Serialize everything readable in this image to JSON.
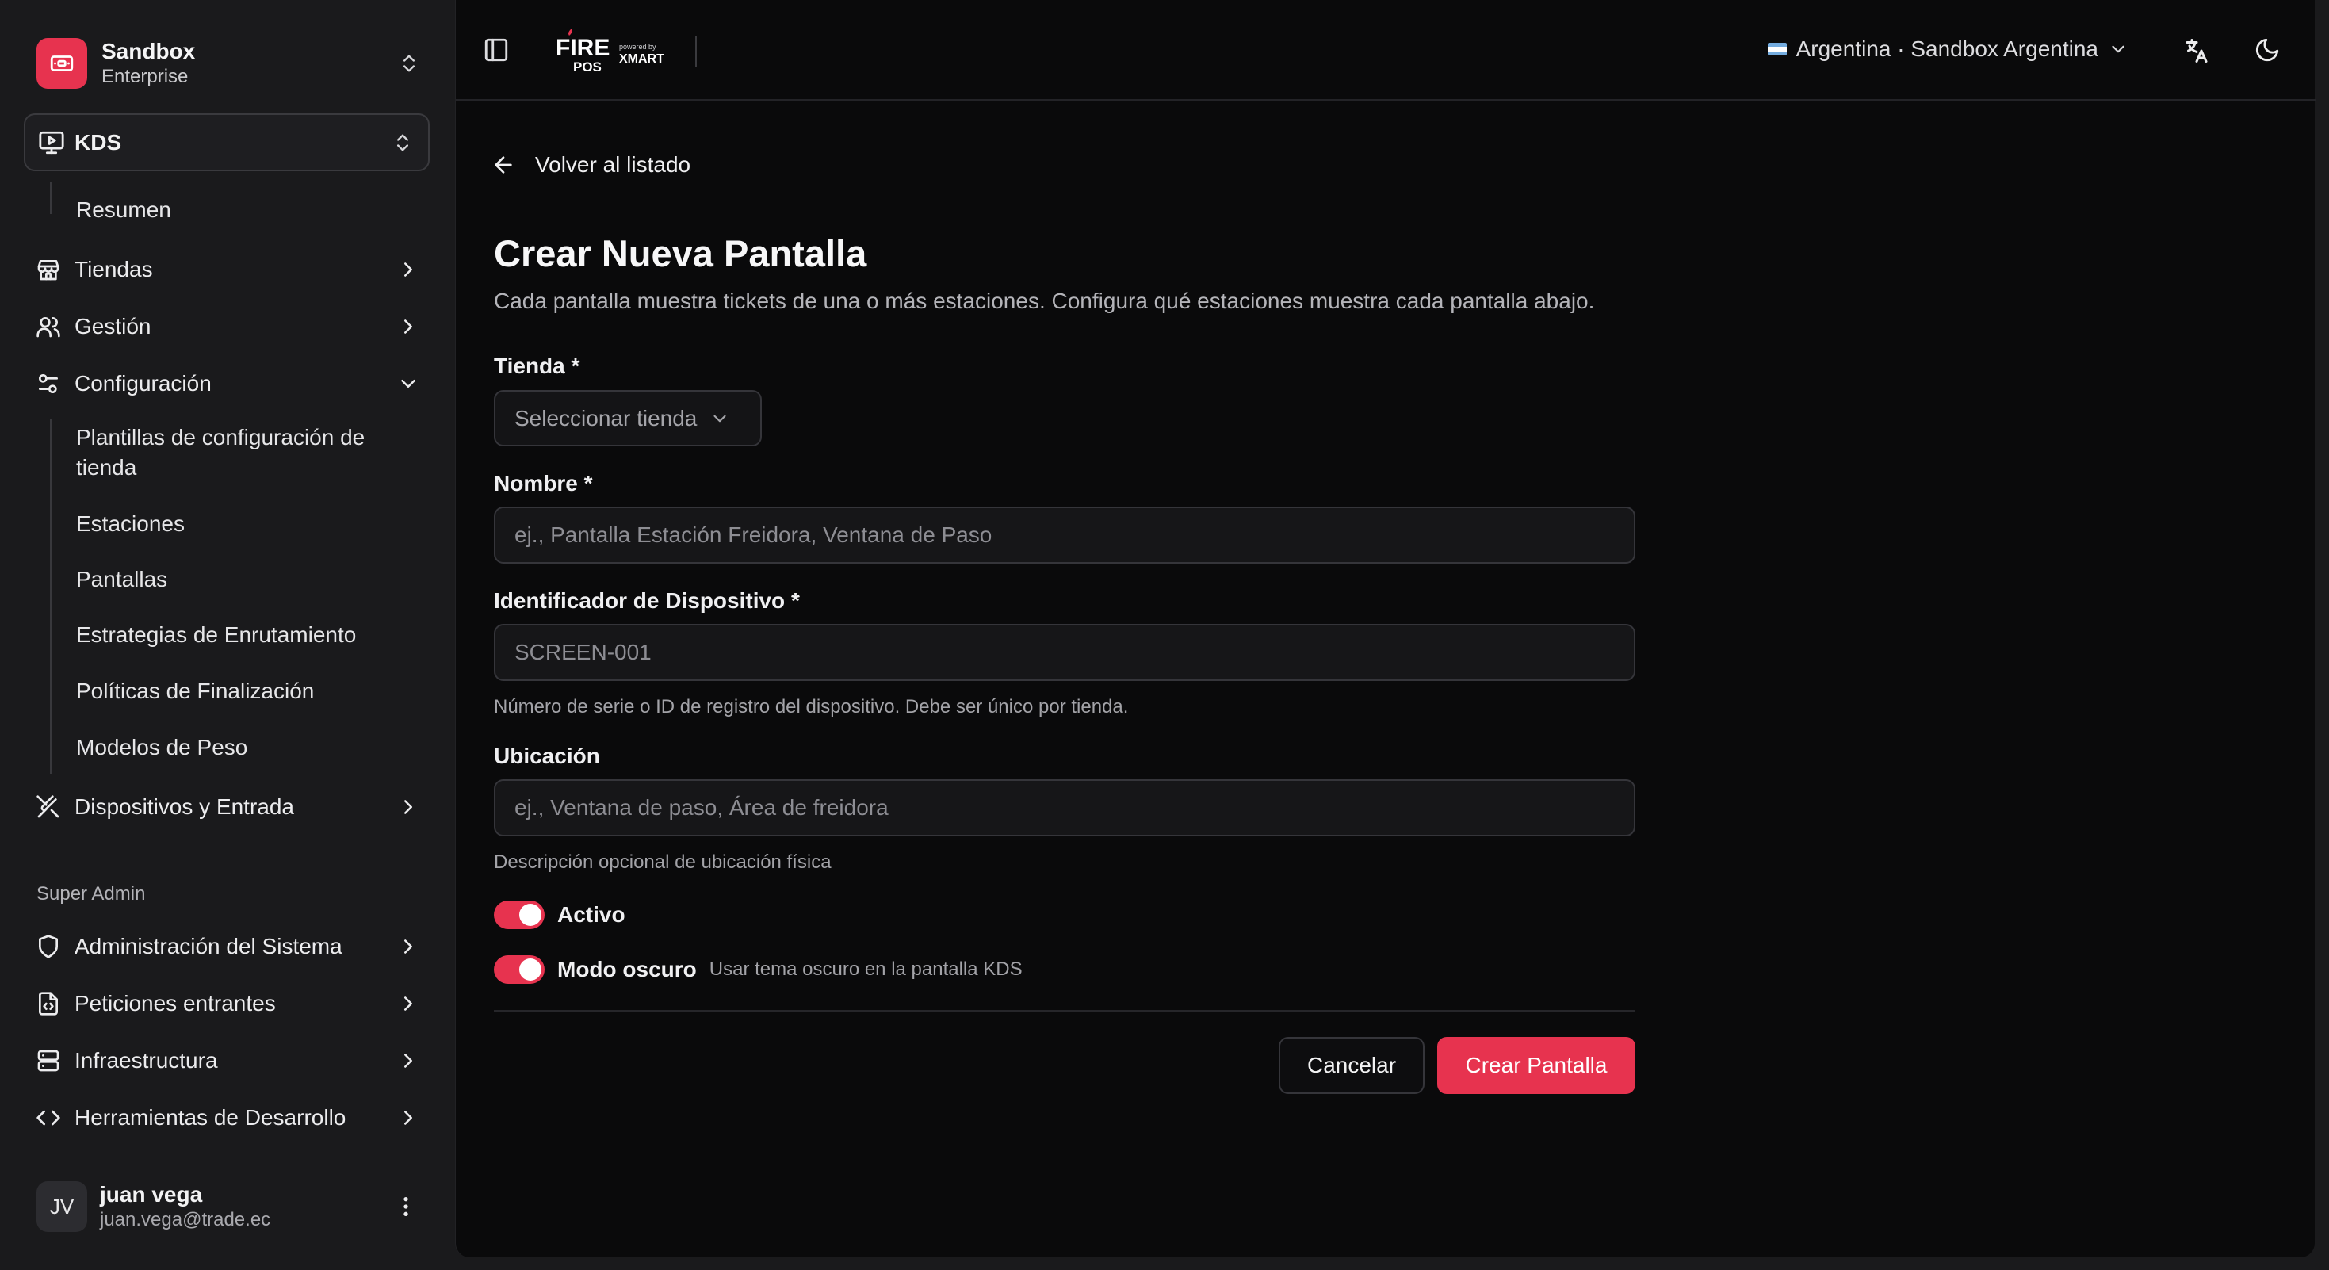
{
  "org": {
    "name": "Sandbox",
    "plan": "Enterprise"
  },
  "module": {
    "label": "KDS"
  },
  "nav": {
    "resumen": "Resumen",
    "tiendas": "Tiendas",
    "gestion": "Gestión",
    "configuracion": "Configuración",
    "config_sub": [
      "Plantillas de configuración de tienda",
      "Estaciones",
      "Pantallas",
      "Estrategias de Enrutamiento",
      "Políticas de Finalización",
      "Modelos de Peso"
    ],
    "dispositivos": "Dispositivos y Entrada",
    "super_admin_title": "Super Admin",
    "admin": [
      "Administración del Sistema",
      "Peticiones entrantes",
      "Infraestructura",
      "Herramientas de Desarrollo"
    ]
  },
  "user": {
    "initials": "JV",
    "name": "juan vega",
    "email": "juan.vega@trade.ec"
  },
  "topbar": {
    "logo_main": "FIRE",
    "logo_sub": "POS",
    "powered_by": "powered by",
    "powered_brand": "XMART",
    "country": "Argentina · Sandbox Argentina"
  },
  "form": {
    "back_label": "Volver al listado",
    "title": "Crear Nueva Pantalla",
    "description": "Cada pantalla muestra tickets de una o más estaciones. Configura qué estaciones muestra cada pantalla abajo.",
    "store_label": "Tienda *",
    "store_placeholder": "Seleccionar tienda",
    "name_label": "Nombre *",
    "name_placeholder": "ej., Pantalla Estación Freidora, Ventana de Paso",
    "device_label": "Identificador de Dispositivo *",
    "device_placeholder": "SCREEN-001",
    "device_help": "Número de serie o ID de registro del dispositivo. Debe ser único por tienda.",
    "location_label": "Ubicación",
    "location_placeholder": "ej., Ventana de paso, Área de freidora",
    "location_help": "Descripción opcional de ubicación física",
    "active_label": "Activo",
    "active_on": true,
    "dark_label": "Modo oscuro",
    "dark_desc": "Usar tema oscuro en la pantalla KDS",
    "dark_on": true,
    "cancel_label": "Cancelar",
    "submit_label": "Crear Pantalla"
  },
  "colors": {
    "accent": "#e7334f",
    "background": "#0a0a0b",
    "sidebar": "#1a1a1c"
  }
}
